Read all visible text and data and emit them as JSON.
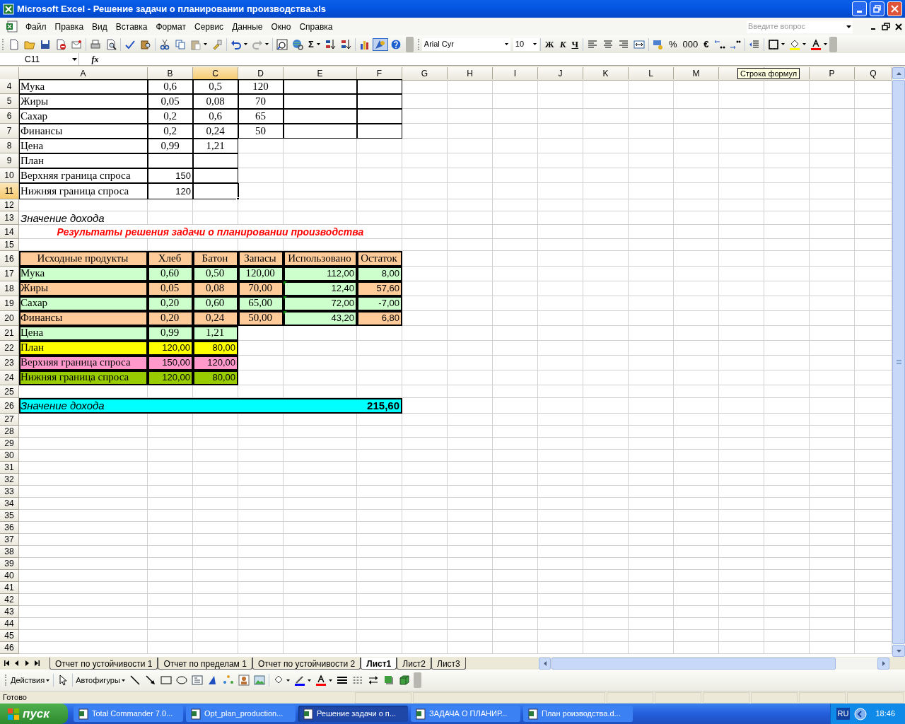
{
  "window": {
    "title": "Microsoft Excel - Решение задачи о планировании производства.xls"
  },
  "menu": [
    "Файл",
    "Правка",
    "Вид",
    "Вставка",
    "Формат",
    "Сервис",
    "Данные",
    "Окно",
    "Справка"
  ],
  "help_search": {
    "placeholder": "Введите вопрос"
  },
  "toolbar": {
    "autosum": "Σ",
    "font": "Arial Cyr",
    "size": "10",
    "bold": "Ж",
    "italic": "К",
    "underline": "Ч",
    "percent": "%",
    "thousands": "000",
    "euro": "€"
  },
  "name_box": "C11",
  "function_label": "fx",
  "tooltip": "Строка формул",
  "sheet": {
    "columns": [
      {
        "label": "A",
        "selected": false
      },
      {
        "label": "B",
        "selected": false
      },
      {
        "label": "C",
        "selected": true
      },
      {
        "label": "D",
        "selected": false
      },
      {
        "label": "E",
        "selected": false
      },
      {
        "label": "F",
        "selected": false
      },
      {
        "label": "G",
        "selected": false
      },
      {
        "label": "H",
        "selected": false
      },
      {
        "label": "I",
        "selected": false
      },
      {
        "label": "J",
        "selected": false
      },
      {
        "label": "K",
        "selected": false
      },
      {
        "label": "L",
        "selected": false
      },
      {
        "label": "M",
        "selected": false
      },
      {
        "selected": false
      },
      {
        "selected": false
      },
      {
        "label": "P",
        "selected": false
      },
      {
        "label": "Q",
        "selected": false
      }
    ],
    "rows": [
      {
        "number": "4",
        "selected": false,
        "cells": [
          {
            "kind": "label",
            "text": "Мука"
          },
          {
            "kind": "value",
            "text": "0,6"
          },
          {
            "kind": "value",
            "text": "0,5"
          },
          {
            "kind": "value",
            "text": "120"
          },
          {
            "kind": "blank"
          },
          {
            "kind": "blank"
          }
        ]
      },
      {
        "number": "5",
        "selected": false,
        "cells": [
          {
            "kind": "label",
            "text": "Жиры"
          },
          {
            "kind": "value",
            "text": "0,05"
          },
          {
            "kind": "value",
            "text": "0,08"
          },
          {
            "kind": "value",
            "text": "70"
          },
          {
            "kind": "blank"
          },
          {
            "kind": "blank"
          }
        ]
      },
      {
        "number": "6",
        "selected": false,
        "cells": [
          {
            "kind": "label",
            "text": "Сахар"
          },
          {
            "kind": "value",
            "text": "0,2"
          },
          {
            "kind": "value",
            "text": "0,6"
          },
          {
            "kind": "value",
            "text": "65"
          },
          {
            "kind": "blank"
          },
          {
            "kind": "blank"
          }
        ]
      },
      {
        "number": "7",
        "selected": false,
        "cells": [
          {
            "kind": "label",
            "text": "Финансы"
          },
          {
            "kind": "value",
            "text": "0,2"
          },
          {
            "kind": "value",
            "text": "0,24"
          },
          {
            "kind": "value",
            "text": "50"
          },
          {
            "kind": "blank"
          },
          {
            "kind": "blank"
          }
        ]
      },
      {
        "number": "8",
        "selected": false,
        "cells": [
          {
            "kind": "label",
            "text": "Цена"
          },
          {
            "kind": "value",
            "text": "0,99"
          },
          {
            "kind": "value",
            "text": "1,21"
          }
        ]
      },
      {
        "number": "9",
        "selected": false,
        "cells": [
          {
            "kind": "label",
            "text": "План"
          },
          {
            "kind": "blank"
          },
          {
            "kind": "blank"
          }
        ]
      },
      {
        "number": "10",
        "selected": false,
        "cells": [
          {
            "kind": "label",
            "text": "Верхняя граница спроса"
          },
          {
            "kind": "number",
            "text": "150"
          },
          {
            "kind": "blank"
          }
        ]
      },
      {
        "number": "11",
        "selected": true,
        "cells": [
          {
            "kind": "label",
            "text": "Нижняя граница спроса"
          },
          {
            "kind": "number",
            "text": "120"
          },
          {
            "kind": "blank"
          }
        ]
      },
      {
        "number": "12",
        "selected": false
      },
      {
        "number": "13",
        "selected": false,
        "cells": [
          {
            "kind": "note",
            "text": "Значение дохода"
          }
        ]
      },
      {
        "number": "14",
        "selected": false,
        "cells": [
          {
            "kind": "title",
            "text": "Результаты решения задачи о планировании производства"
          }
        ]
      },
      {
        "number": "15",
        "selected": false
      },
      {
        "number": "16",
        "selected": false,
        "cells": [
          {
            "kind": "value",
            "text": "Исходные продукты",
            "color": "#ffcc99"
          },
          {
            "kind": "value",
            "text": "Хлеб",
            "color": "#ffcc99"
          },
          {
            "kind": "value",
            "text": "Батон",
            "color": "#ffcc99"
          },
          {
            "kind": "value",
            "text": "Запасы",
            "color": "#ffcc99"
          },
          {
            "kind": "value",
            "text": "Использовано",
            "color": "#ffcc99"
          },
          {
            "kind": "value",
            "text": "Остаток",
            "color": "#ffcc99"
          }
        ]
      },
      {
        "number": "17",
        "selected": false,
        "cells": [
          {
            "kind": "label",
            "text": "Мука",
            "color": "#ccffcc"
          },
          {
            "kind": "value",
            "text": "0,60",
            "color": "#ccffcc"
          },
          {
            "kind": "value",
            "text": "0,50",
            "color": "#ccffcc"
          },
          {
            "kind": "value",
            "text": "120,00",
            "color": "#ccffcc"
          },
          {
            "kind": "number",
            "text": "112,00",
            "color": "#ccffcc"
          },
          {
            "kind": "number",
            "text": "8,00",
            "color": "#ccffcc"
          }
        ]
      },
      {
        "number": "18",
        "selected": false,
        "cells": [
          {
            "kind": "label",
            "text": "Жиры",
            "color": "#ffcc99"
          },
          {
            "kind": "value",
            "text": "0,05",
            "color": "#ffcc99"
          },
          {
            "kind": "value",
            "text": "0,08",
            "color": "#ffcc99"
          },
          {
            "kind": "value",
            "text": "70,00",
            "color": "#ffcc99"
          },
          {
            "kind": "number",
            "text": "12,40",
            "color": "#ccffcc",
            "error_mark": true
          },
          {
            "kind": "number",
            "text": "57,60",
            "color": "#ffcc99"
          }
        ]
      },
      {
        "number": "19",
        "selected": false,
        "cells": [
          {
            "kind": "label",
            "text": "Сахар",
            "color": "#ccffcc"
          },
          {
            "kind": "value",
            "text": "0,20",
            "color": "#ccffcc"
          },
          {
            "kind": "value",
            "text": "0,60",
            "color": "#ccffcc"
          },
          {
            "kind": "value",
            "text": "65,00",
            "color": "#ccffcc"
          },
          {
            "kind": "number",
            "text": "72,00",
            "color": "#ccffcc",
            "error_mark": true
          },
          {
            "kind": "number",
            "text": "-7,00",
            "color": "#ccffcc"
          }
        ]
      },
      {
        "number": "20",
        "selected": false,
        "cells": [
          {
            "kind": "label",
            "text": "Финансы",
            "color": "#ffcc99"
          },
          {
            "kind": "value",
            "text": "0,20",
            "color": "#ffcc99"
          },
          {
            "kind": "value",
            "text": "0,24",
            "color": "#ffcc99"
          },
          {
            "kind": "value",
            "text": "50,00",
            "color": "#ffcc99"
          },
          {
            "kind": "number",
            "text": "43,20",
            "color": "#ccffcc",
            "error_mark": true
          },
          {
            "kind": "number",
            "text": "6,80",
            "color": "#ffcc99"
          }
        ]
      },
      {
        "number": "21",
        "selected": false,
        "cells": [
          {
            "kind": "label",
            "text": "Цена",
            "color": "#ccffcc"
          },
          {
            "kind": "value",
            "text": "0,99",
            "color": "#ccffcc"
          },
          {
            "kind": "value",
            "text": "1,21",
            "color": "#ccffcc"
          }
        ]
      },
      {
        "number": "22",
        "selected": false,
        "cells": [
          {
            "kind": "label",
            "text": "План",
            "color": "#ffff00"
          },
          {
            "kind": "number",
            "text": "120,00",
            "color": "#ffff00"
          },
          {
            "kind": "number",
            "text": "80,00",
            "color": "#ffff00"
          }
        ]
      },
      {
        "number": "23",
        "selected": false,
        "cells": [
          {
            "kind": "label",
            "text": "Верхняя граница спроса",
            "color": "#ff99cc"
          },
          {
            "kind": "number",
            "text": "150,00",
            "color": "#ff99cc"
          },
          {
            "kind": "number",
            "text": "120,00",
            "color": "#ff99cc"
          }
        ]
      },
      {
        "number": "24",
        "selected": false,
        "cells": [
          {
            "kind": "label",
            "text": "Нижняя граница спроса",
            "color": "#99cc00"
          },
          {
            "kind": "number",
            "text": "120,00",
            "color": "#99cc00"
          },
          {
            "kind": "number",
            "text": "80,00",
            "color": "#99cc00"
          }
        ]
      },
      {
        "number": "25",
        "selected": false
      },
      {
        "number": "26",
        "selected": false,
        "cells": [
          {
            "kind": "total",
            "text": "Значение дохода",
            "total": "215,60",
            "color": "#00ffff"
          }
        ]
      },
      {
        "number": "27",
        "selected": false
      },
      {
        "number": "28",
        "selected": false
      },
      {
        "number": "29",
        "selected": false
      },
      {
        "number": "30",
        "selected": false
      },
      {
        "number": "31",
        "selected": false
      },
      {
        "number": "32",
        "selected": false
      },
      {
        "number": "33",
        "selected": false
      },
      {
        "number": "34",
        "selected": false
      },
      {
        "number": "35",
        "selected": false
      },
      {
        "number": "36",
        "selected": false
      },
      {
        "number": "37",
        "selected": false
      },
      {
        "number": "38",
        "selected": false
      },
      {
        "number": "39",
        "selected": false
      },
      {
        "number": "40",
        "selected": false
      },
      {
        "number": "41",
        "selected": false
      },
      {
        "number": "42",
        "selected": false
      },
      {
        "number": "43",
        "selected": false
      },
      {
        "number": "44",
        "selected": false
      },
      {
        "number": "45",
        "selected": false
      },
      {
        "number": "46",
        "selected": false
      }
    ]
  },
  "sheet_tabs": [
    {
      "label": "Отчет по устойчивости 1",
      "selected": false
    },
    {
      "label": "Отчет по пределам 1",
      "selected": false
    },
    {
      "label": "Отчет по устойчивости 2",
      "selected": false
    },
    {
      "label": "Лист1",
      "selected": true
    },
    {
      "label": "Лист2",
      "selected": false
    },
    {
      "label": "Лист3",
      "selected": false
    }
  ],
  "drawing_toolbar": {
    "actions": "Действия",
    "autoshapes": "Автофигуры"
  },
  "status_bar": "Готово",
  "taskbar": {
    "start": "пуск",
    "tasks": [
      {
        "label": "Total Commander 7.0...",
        "selected": false
      },
      {
        "label": "Opt_plan_production...",
        "selected": false
      },
      {
        "label": "Решение задачи о п...",
        "selected": true
      },
      {
        "label": "ЗАДАЧА О ПЛАНИР...",
        "selected": false
      },
      {
        "label": "План роизводства.d...",
        "selected": false
      }
    ],
    "language": "RU",
    "clock": "18:46"
  }
}
